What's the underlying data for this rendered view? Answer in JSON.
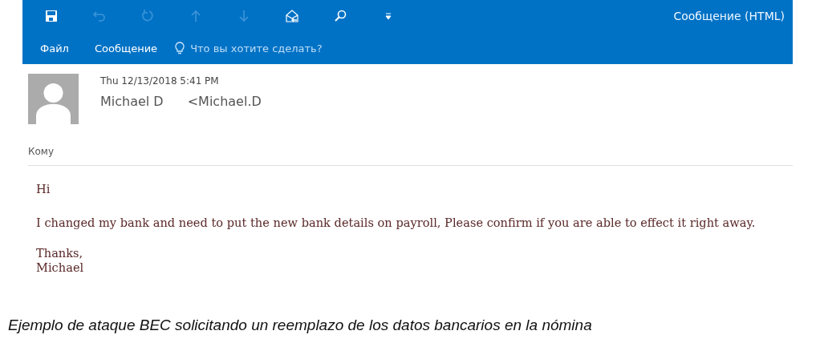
{
  "toolbar": {
    "buttons": [
      {
        "kind": "save",
        "disabled": false
      },
      {
        "kind": "undo",
        "disabled": true
      },
      {
        "kind": "redo",
        "disabled": true
      },
      {
        "kind": "up",
        "disabled": true
      },
      {
        "kind": "down",
        "disabled": true
      },
      {
        "kind": "reply",
        "disabled": false
      },
      {
        "kind": "search",
        "disabled": false
      },
      {
        "kind": "customize",
        "disabled": false
      }
    ],
    "window_title": "Сообщение (HTML)"
  },
  "ribbon": {
    "tabs": [
      "Файл",
      "Сообщение"
    ],
    "tell_me": {
      "placeholder": "Что вы хотите сделать?"
    }
  },
  "header": {
    "date": "Thu 12/13/2018 5:41 PM",
    "sender_name": "Michael D",
    "sender_address": "<Michael.D",
    "to_label": "Кому"
  },
  "body": [
    "Hi",
    "I changed my bank and need to put the new bank details on payroll, Please confirm if you are able to effect it right away.",
    "Thanks,\nMichael"
  ],
  "caption": "Ejemplo de ataque BEC solicitando un reemplazo de los datos bancarios en la nómina"
}
